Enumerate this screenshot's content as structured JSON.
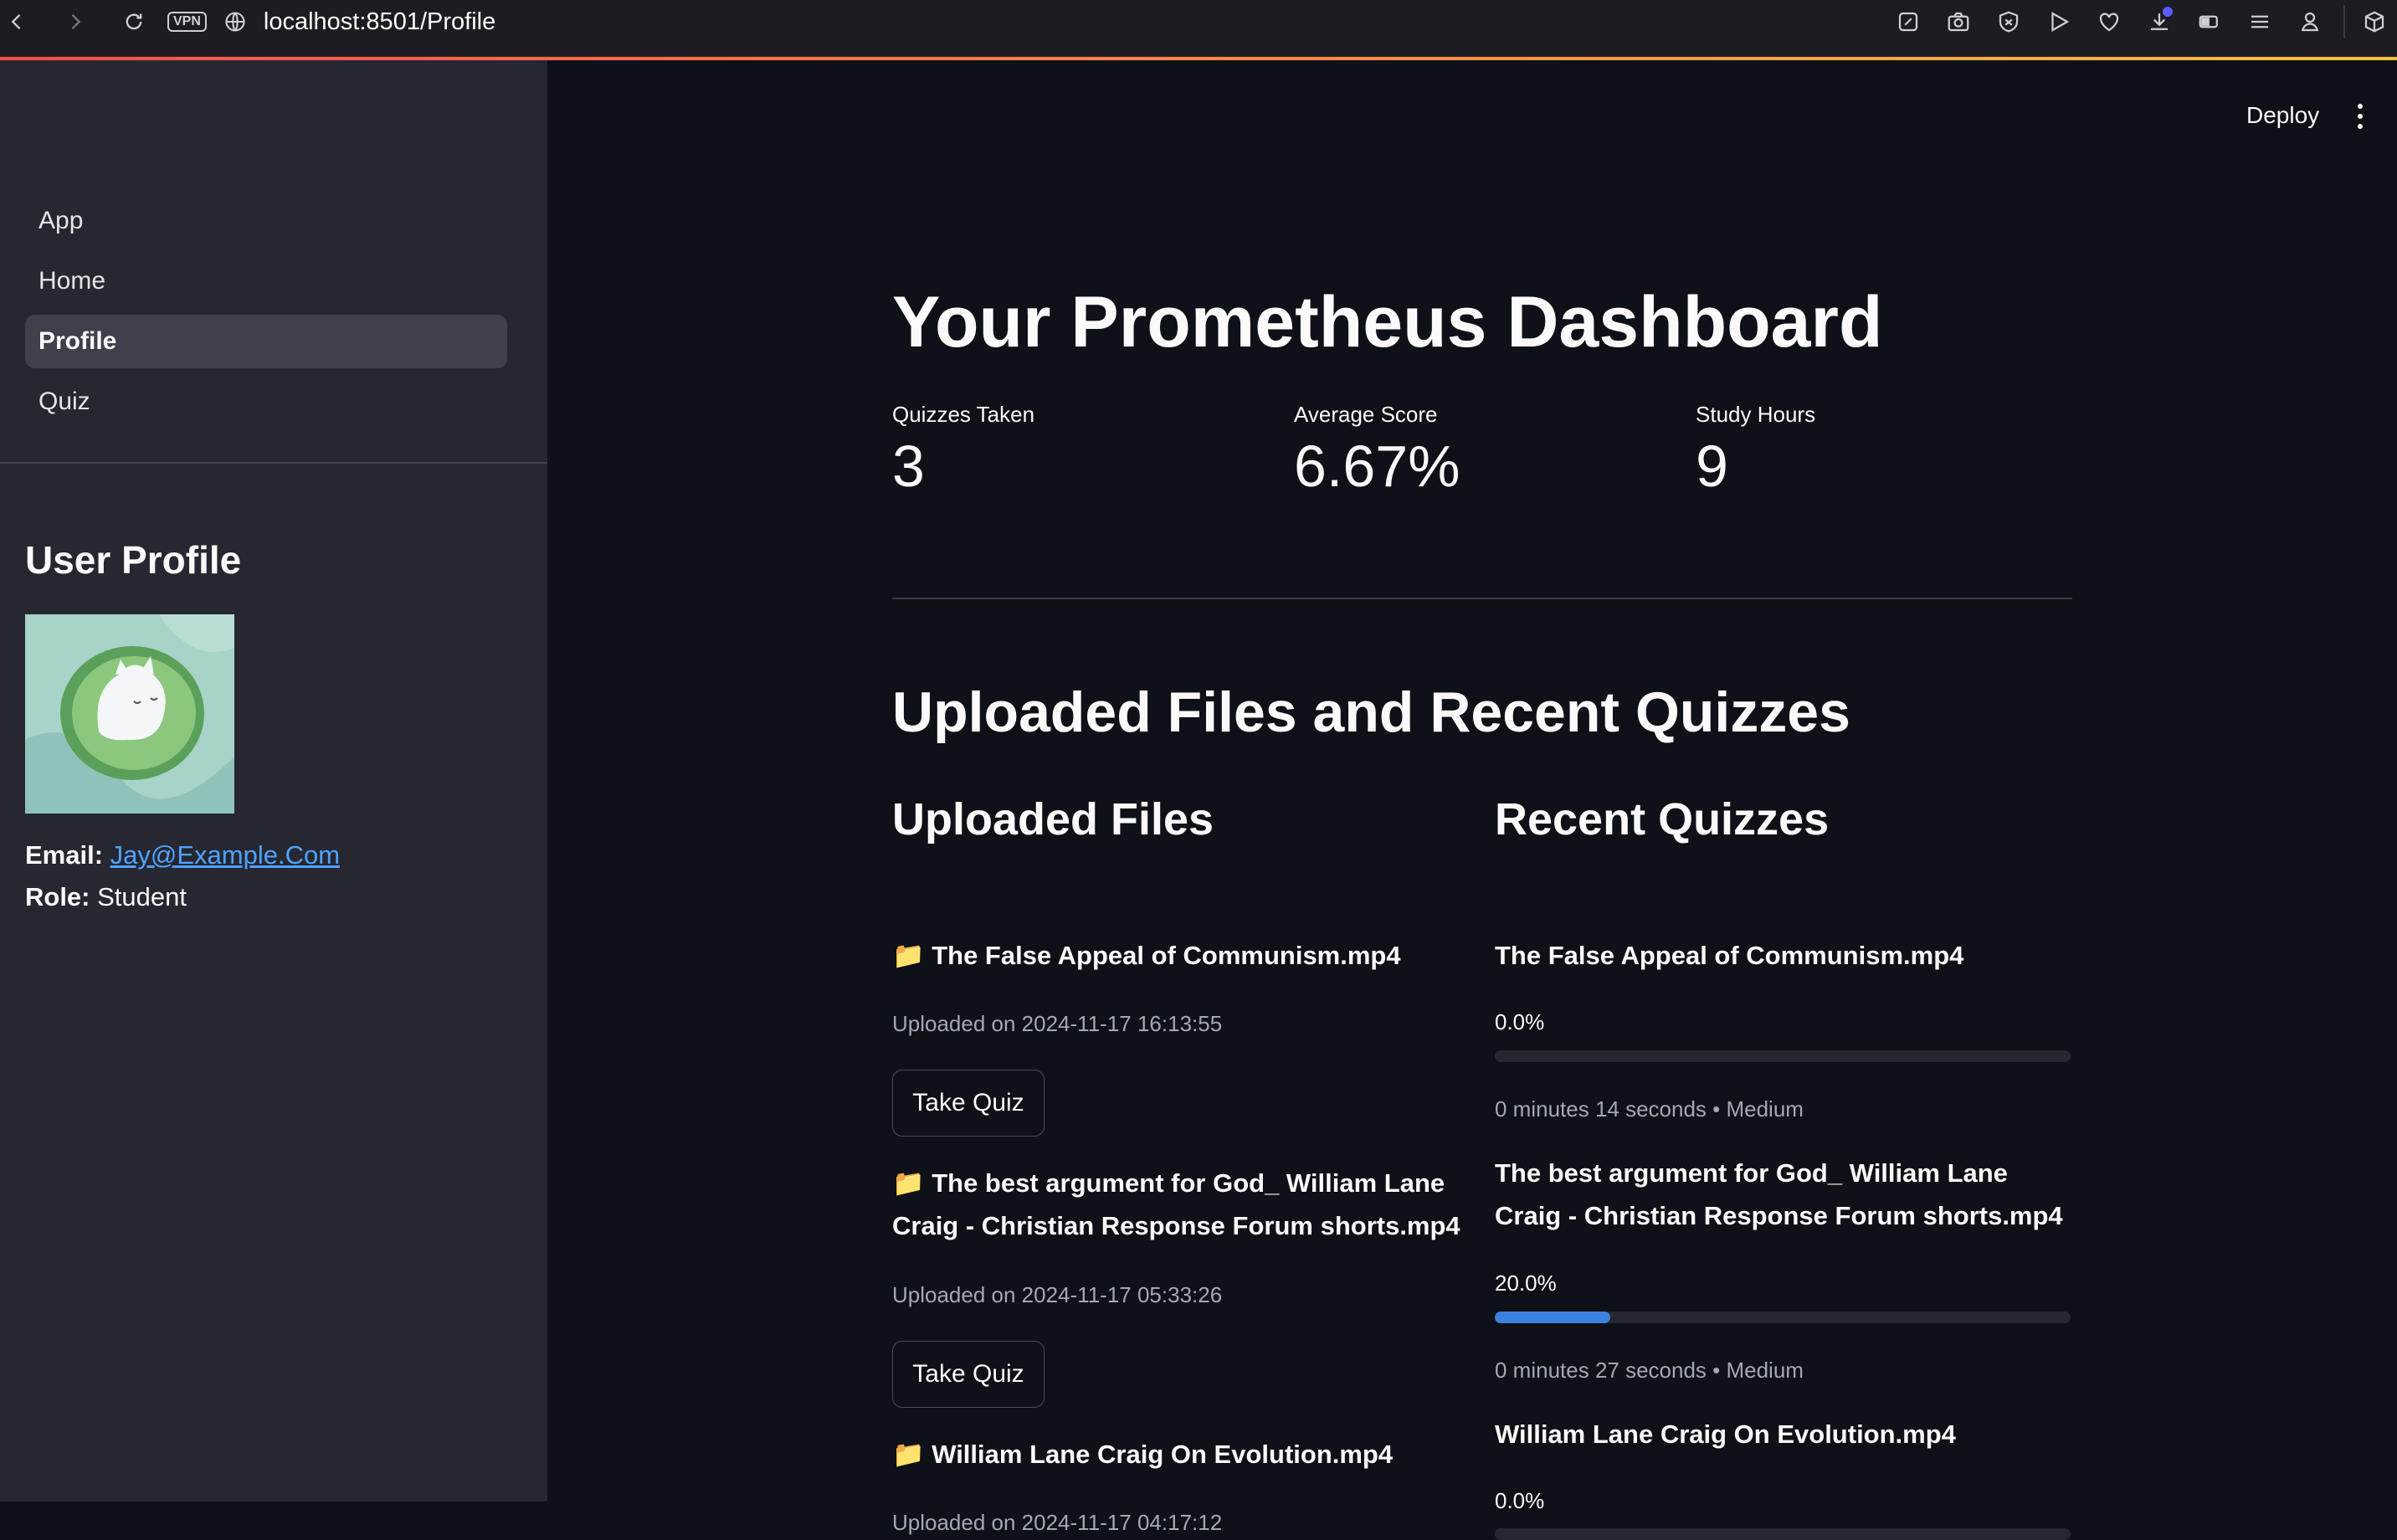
{
  "browser": {
    "vpn_label": "VPN",
    "url_host": "localhost",
    "url_rest": ":8501/Profile"
  },
  "sidebar": {
    "nav": [
      {
        "label": "App",
        "active": false
      },
      {
        "label": "Home",
        "active": false
      },
      {
        "label": "Profile",
        "active": true
      },
      {
        "label": "Quiz",
        "active": false
      }
    ],
    "profile_title": "User Profile",
    "email_label": "Email:",
    "email_value": "Jay@Example.Com",
    "role_label": "Role:",
    "role_value": "Student"
  },
  "header": {
    "deploy_label": "Deploy"
  },
  "main": {
    "title": "Your Prometheus Dashboard",
    "metrics": [
      {
        "label": "Quizzes Taken",
        "value": "3"
      },
      {
        "label": "Average Score",
        "value": "6.67%"
      },
      {
        "label": "Study Hours",
        "value": "9"
      }
    ],
    "section_title": "Uploaded Files and Recent Quizzes",
    "uploaded_title": "Uploaded Files",
    "recent_title": "Recent Quizzes",
    "files": [
      {
        "name": "📁 The False Appeal of Communism.mp4",
        "uploaded": "Uploaded on 2024-11-17 16:13:55",
        "button": "Take Quiz"
      },
      {
        "name": "📁 The best argument for God_ William Lane Craig - Christian Response Forum shorts.mp4",
        "uploaded": "Uploaded on 2024-11-17 05:33:26",
        "button": "Take Quiz"
      },
      {
        "name": "📁 William Lane Craig On Evolution.mp4",
        "uploaded": "Uploaded on 2024-11-17 04:17:12"
      }
    ],
    "quizzes": [
      {
        "name": "The False Appeal of Communism.mp4",
        "score_label": "0.0%",
        "progress": 0.0,
        "meta": "0 minutes 14 seconds • Medium"
      },
      {
        "name": "The best argument for God_ William Lane Craig - Christian Response Forum shorts.mp4",
        "score_label": "20.0%",
        "progress": 0.2,
        "meta": "0 minutes 27 seconds • Medium"
      },
      {
        "name": "William Lane Craig On Evolution.mp4",
        "score_label": "0.0%",
        "progress": 0.0
      }
    ]
  },
  "colors": {
    "background": "#0e1117",
    "sidebar": "#262730",
    "link": "#4ea3ff",
    "progress_fill": "#3b82e0"
  }
}
